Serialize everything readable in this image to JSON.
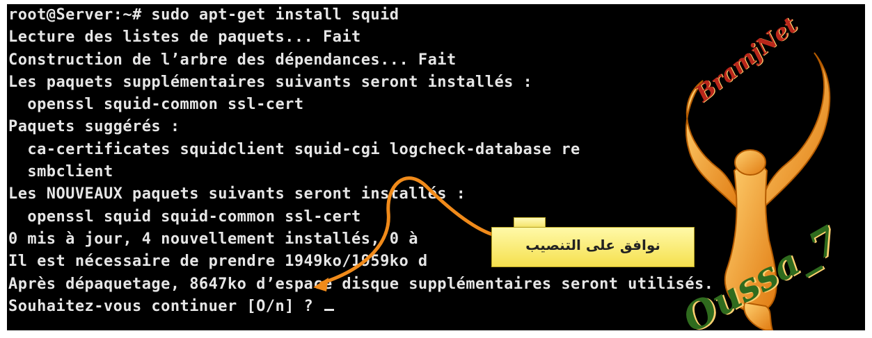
{
  "terminal": {
    "lines": [
      "root@Server:~# sudo apt-get install squid",
      "Lecture des listes de paquets... Fait",
      "Construction de l’arbre des dépendances... Fait",
      "Les paquets supplémentaires suivants seront installés :",
      "  openssl squid-common ssl-cert",
      "Paquets suggérés :",
      "  ca-certificates squidclient squid-cgi logcheck-database re",
      "  smbclient",
      "Les NOUVEAUX paquets suivants seront installés :",
      "  openssl squid squid-common ssl-cert",
      "0 mis à jour, 4 nouvellement installés, 0 à",
      "Il est nécessaire de prendre 1949ko/1959ko d",
      "Après dépaquetage, 8647ko d’espace disque supplémentaires seront utilisés.",
      "Souhaitez-vous continuer [O/n] ? "
    ],
    "cursor": "_"
  },
  "callout": {
    "text": "نوافق على التنصيب",
    "color": "#f5e04e"
  },
  "watermark": {
    "top_text": "BramjNet",
    "bottom_text": "Oussa_7",
    "colors": {
      "bird": "#f0a020",
      "top_text": "#b8261a",
      "bottom_text": "#2f6b1e"
    }
  }
}
